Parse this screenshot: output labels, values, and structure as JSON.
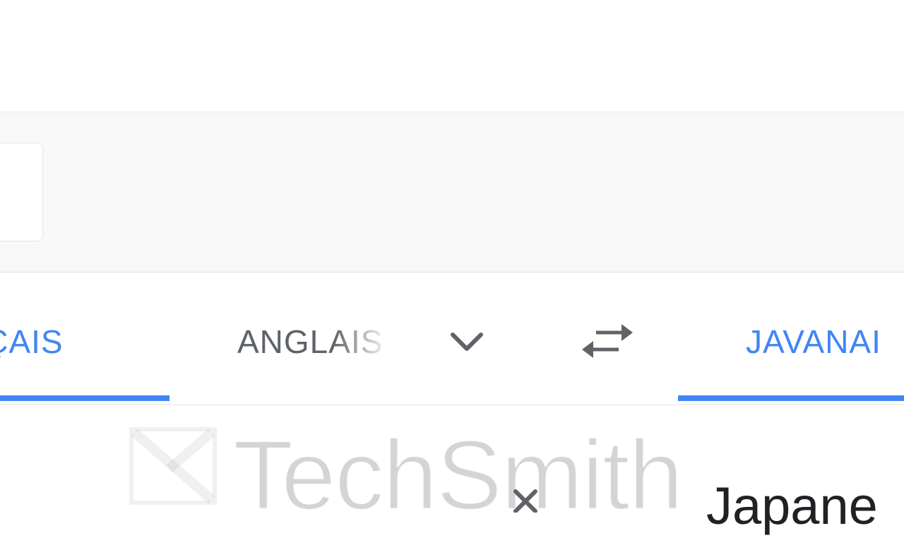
{
  "language_bar": {
    "source_active_label": "NÇAIS",
    "source_alt_label": "ANGLAIS",
    "target_active_label": "JAVANAI"
  },
  "icons": {
    "chevron": "chevron-down-icon",
    "swap": "swap-languages-icon",
    "clear": "close-icon"
  },
  "colors": {
    "accent": "#4285f4",
    "inactive_text": "#5f6368",
    "icon": "#5f6368",
    "toolbar_bg": "#f8f8f8"
  },
  "output": {
    "translation_text": "Japane"
  },
  "watermark": {
    "text": "TechSmith"
  }
}
